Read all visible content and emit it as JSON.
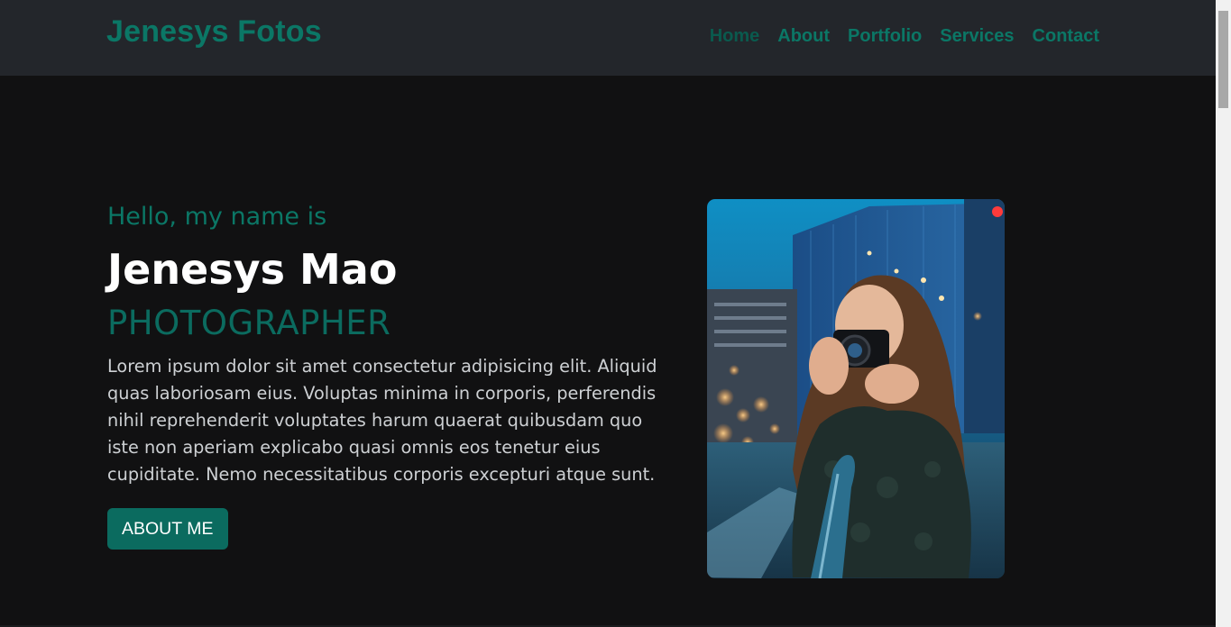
{
  "navbar": {
    "brand": "Jenesys Fotos",
    "links": [
      {
        "label": "Home",
        "active": true
      },
      {
        "label": "About",
        "active": false
      },
      {
        "label": "Portfolio",
        "active": false
      },
      {
        "label": "Services",
        "active": false
      },
      {
        "label": "Contact",
        "active": false
      }
    ]
  },
  "hero": {
    "greeting": "Hello, my name is",
    "name": "Jenesys Mao",
    "role": "PHOTOGRAPHER",
    "bio": "Lorem ipsum dolor sit amet consectetur adipisicing elit. Aliquid quas laboriosam eius. Voluptas minima in corporis, perferendis nihil reprehenderit voluptates harum quaerat quibusdam quo iste non aperiam explicabo quasi omnis eos tenetur eius cupiditate. Nemo necessitatibus corporis excepturi atque sunt.",
    "button_label": "ABOUT ME",
    "photo_alt_icon": "photographer-photo"
  },
  "colors": {
    "accent": "#0b7766",
    "nav_bg": "#23262b",
    "page_bg": "#111112",
    "button_bg": "#0b6b5f"
  }
}
